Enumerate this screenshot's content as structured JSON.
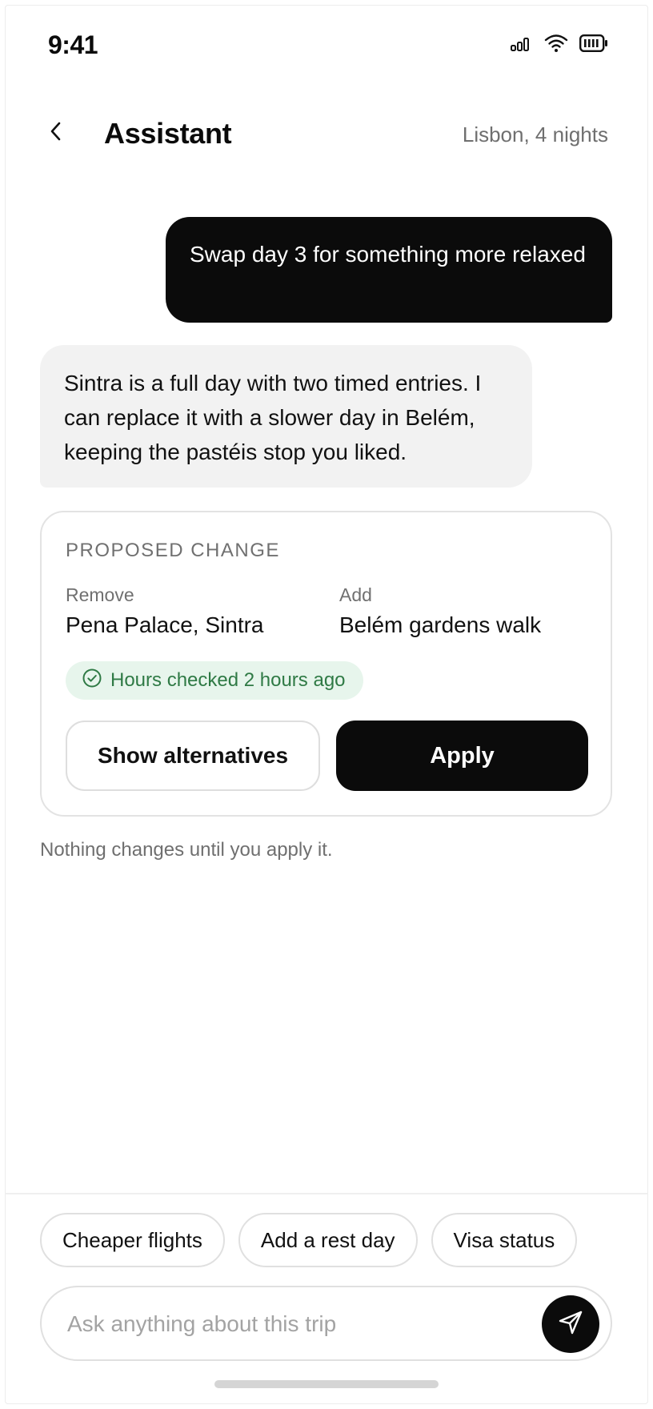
{
  "status_bar": {
    "time": "9:41",
    "icons": [
      "signal-icon",
      "wifi-icon",
      "battery-icon"
    ]
  },
  "header": {
    "back_icon": "chevron-left-icon",
    "title": "Assistant",
    "context": "Lisbon, 4 nights"
  },
  "messages": [
    {
      "role": "user",
      "text": "Swap day 3 for something more relaxed"
    },
    {
      "role": "assistant",
      "text": "Sintra is a full day with two timed entries. I can replace it with a slower day in Belém, keeping the pastéis stop you liked."
    }
  ],
  "proposal": {
    "eyebrow": "PROPOSED CHANGE",
    "remove_label": "Remove",
    "remove_value": "Pena Palace, Sintra",
    "add_label": "Add",
    "add_value": "Belém gardens walk",
    "badge": "Hours checked 2 hours ago",
    "badge_icon": "check-circle-icon",
    "secondary_action": "Show alternatives",
    "primary_action": "Apply"
  },
  "footnote": "Nothing changes until you apply it.",
  "suggestions": [
    "Cheaper flights",
    "Add a rest day",
    "Visa status"
  ],
  "composer": {
    "placeholder": "Ask anything about this trip",
    "value": "",
    "send_icon": "send-icon"
  },
  "colors": {
    "accent": "#0b0b0b",
    "badge_bg": "#e7f5ec",
    "badge_text": "#2f7a45",
    "muted": "#6f6f6f"
  }
}
